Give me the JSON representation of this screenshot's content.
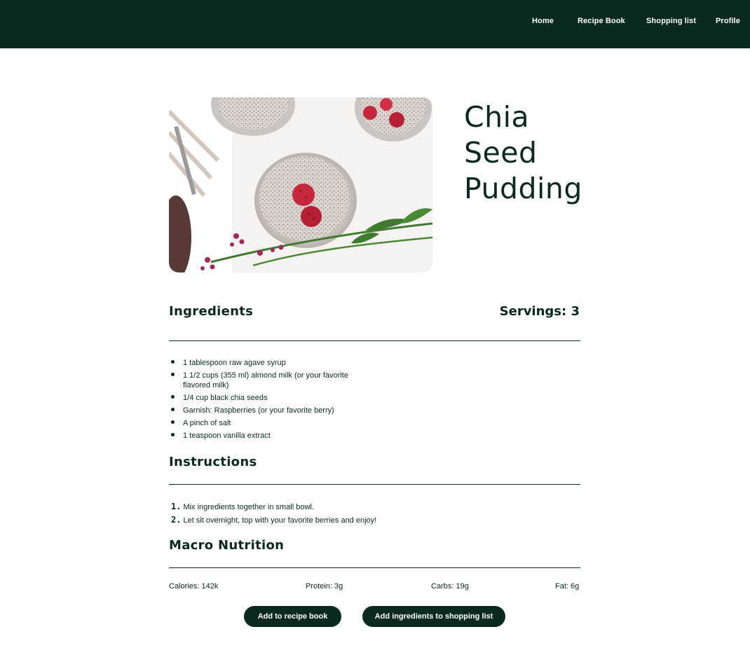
{
  "nav": {
    "items": [
      {
        "label": "Home"
      },
      {
        "label": "Recipe Book"
      },
      {
        "label": "Shopping list"
      },
      {
        "label": "Profile"
      }
    ]
  },
  "recipe": {
    "title_lines": [
      "Chia",
      "Seed",
      "Pudding"
    ],
    "image_icon": "chia-pudding-photo"
  },
  "ingredients": {
    "heading": "Ingredients",
    "servings_label": "Servings: 3",
    "items": [
      "1 tablespoon raw agave syrup",
      "1 1/2 cups (355 ml) almond milk (or your favorite flavored milk)",
      "1/4 cup black chia seeds",
      "Garnish: Raspberries (or your favorite berry)",
      "A pinch of salt",
      "1 teaspoon vanilla extract"
    ]
  },
  "instructions": {
    "heading": "Instructions",
    "steps": [
      {
        "num": "1.",
        "text": "Mix ingredients together in small bowl."
      },
      {
        "num": "2.",
        "text": "Let sit overnight, top with your favorite berries and enjoy!"
      }
    ]
  },
  "nutrition": {
    "heading": "Macro Nutrition",
    "calories": "Calories: 142k",
    "protein": "Protein: 3g",
    "carbs": "Carbs: 19g",
    "fat": "Fat: 6g"
  },
  "actions": {
    "add_to_book": "Add to recipe book",
    "add_to_list": "Add ingredients to shopping list"
  },
  "colors": {
    "primary": "#0b2a1f",
    "background": "#ffffff",
    "button_text": "#ffffff"
  }
}
